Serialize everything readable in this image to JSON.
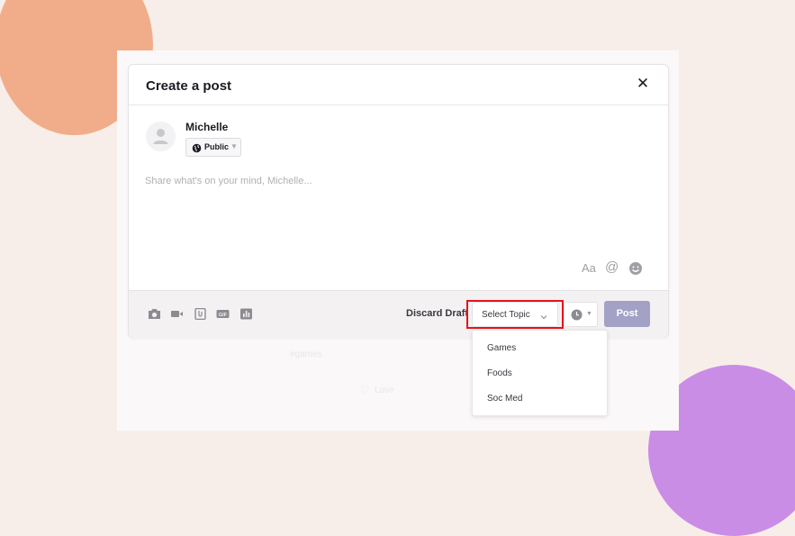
{
  "modal": {
    "title": "Create a post",
    "close_icon": "close-icon"
  },
  "author": {
    "name": "Michelle",
    "privacy": {
      "label": "Public",
      "icon": "globe-icon"
    }
  },
  "composer": {
    "value": "",
    "placeholder": "Share what's on your mind, Michelle...",
    "text_format_label": "Aa",
    "mention_label": "@",
    "emoji_icon": "emoji-icon"
  },
  "toolbar": {
    "tools": [
      "camera-icon",
      "video-icon",
      "attachment-icon",
      "gif-icon",
      "poll-icon"
    ],
    "discard_label": "Discard Draft",
    "topic_select": {
      "selected": "Select Topic",
      "options": [
        "Games",
        "Foods",
        "Soc Med"
      ]
    },
    "schedule_icon": "clock-icon",
    "post_label": "Post"
  },
  "background_post": {
    "tag": "#games",
    "love_label": "Love"
  },
  "colors": {
    "page_background": "#f8eee9",
    "accent_orange": "#f1ad89",
    "accent_purple": "#c98de6",
    "post_button": "#a3a1c6",
    "highlight": "#e5141c"
  }
}
